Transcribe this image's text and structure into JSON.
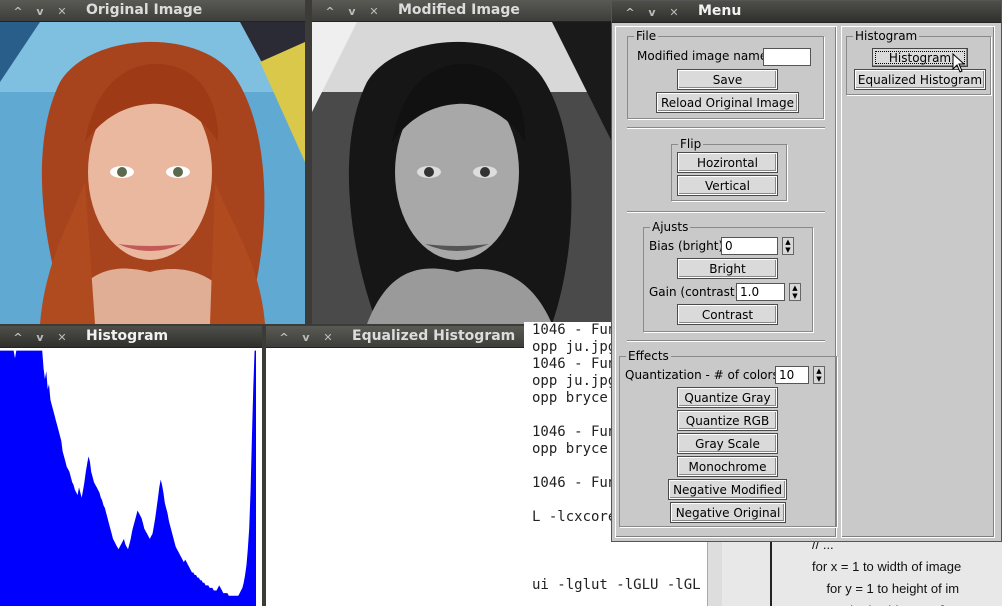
{
  "windows": {
    "original": {
      "title": "Original Image"
    },
    "modified": {
      "title": "Modified Image"
    },
    "histogram": {
      "title": "Histogram"
    },
    "equalized": {
      "title": "Equalized Histogram"
    },
    "menu": {
      "title": "Menu"
    }
  },
  "terminal": {
    "lines": [
      "1046 - Fun",
      "opp ju.jpg",
      "1046 - Fun",
      "opp ju.jpg",
      "opp bryce",
      "",
      "1046 - Fun",
      "opp bryce",
      "",
      "1046 - Fun",
      "",
      "L -lcxcore",
      "",
      "",
      "",
      "ui -lglut -lGLU -lGL"
    ]
  },
  "code": {
    "lines": [
      "// ...",
      "for x = 1 to width of image",
      "    for y = 1 to height of im",
      "        g(x,y) = hist_cum["
    ]
  },
  "menu": {
    "file": {
      "legend": "File",
      "name_label": "Modified image name:",
      "name_value": "",
      "save": "Save",
      "reload": "Reload Original Image"
    },
    "flip": {
      "legend": "Flip",
      "horizontal": "Hozirontal",
      "vertical": "Vertical"
    },
    "ajusts": {
      "legend": "Ajusts",
      "bias_label": "Bias (bright):",
      "bias_value": "0",
      "bright": "Bright",
      "gain_label": "Gain (contrast):",
      "gain_value": "1.0",
      "contrast": "Contrast"
    },
    "effects": {
      "legend": "Effects",
      "quant_label": "Quantization - # of colors:",
      "quant_value": "10",
      "quantize_gray": "Quantize Gray",
      "quantize_rgb": "Quantize RGB",
      "gray_scale": "Gray Scale",
      "monochrome": "Monochrome",
      "negative_modified": "Negative Modified",
      "negative_original": "Negative Original"
    },
    "histogram": {
      "legend": "Histogram",
      "histogram": "Histogram",
      "equalized": "Equalized Histogram"
    }
  },
  "colors": {
    "histogram_fill": "#0000ff",
    "titlebar": "#3c3b37",
    "panel": "#c9c9c9"
  },
  "histogram_data": [
    0.99,
    0.99,
    0.99,
    0.99,
    0.99,
    0.99,
    0.99,
    0.99,
    0.99,
    0.99,
    0.99,
    0.96,
    0.99,
    0.99,
    0.99,
    0.99,
    0.99,
    0.99,
    0.99,
    0.99,
    0.99,
    0.99,
    0.99,
    0.99,
    0.99,
    0.99,
    0.99,
    0.99,
    0.99,
    0.99,
    0.99,
    0.99,
    0.92,
    0.88,
    0.91,
    0.84,
    0.86,
    0.8,
    0.78,
    0.76,
    0.74,
    0.72,
    0.7,
    0.68,
    0.66,
    0.64,
    0.6,
    0.58,
    0.56,
    0.54,
    0.53,
    0.52,
    0.5,
    0.48,
    0.47,
    0.45,
    0.44,
    0.43,
    0.46,
    0.44,
    0.42,
    0.45,
    0.48,
    0.52,
    0.55,
    0.58,
    0.56,
    0.52,
    0.5,
    0.48,
    0.47,
    0.46,
    0.45,
    0.44,
    0.42,
    0.41,
    0.39,
    0.38,
    0.36,
    0.34,
    0.32,
    0.3,
    0.28,
    0.26,
    0.25,
    0.24,
    0.23,
    0.22,
    0.23,
    0.24,
    0.25,
    0.26,
    0.24,
    0.23,
    0.22,
    0.24,
    0.26,
    0.29,
    0.31,
    0.33,
    0.35,
    0.37,
    0.36,
    0.35,
    0.34,
    0.32,
    0.3,
    0.29,
    0.28,
    0.27,
    0.26,
    0.27,
    0.28,
    0.31,
    0.34,
    0.38,
    0.42,
    0.46,
    0.49,
    0.47,
    0.44,
    0.4,
    0.38,
    0.36,
    0.33,
    0.31,
    0.29,
    0.27,
    0.25,
    0.23,
    0.22,
    0.21,
    0.2,
    0.19,
    0.18,
    0.17,
    0.18,
    0.17,
    0.16,
    0.15,
    0.14,
    0.13,
    0.13,
    0.12,
    0.12,
    0.11,
    0.11,
    0.1,
    0.1,
    0.09,
    0.09,
    0.08,
    0.08,
    0.08,
    0.07,
    0.07,
    0.07,
    0.06,
    0.06,
    0.06,
    0.07,
    0.08,
    0.07,
    0.06,
    0.05,
    0.05,
    0.05,
    0.05,
    0.04,
    0.04,
    0.04,
    0.04,
    0.04,
    0.04,
    0.04,
    0.04,
    0.05,
    0.06,
    0.07,
    0.09,
    0.12,
    0.16,
    0.22,
    0.3,
    0.45,
    0.65,
    0.85,
    0.99,
    0.99
  ]
}
